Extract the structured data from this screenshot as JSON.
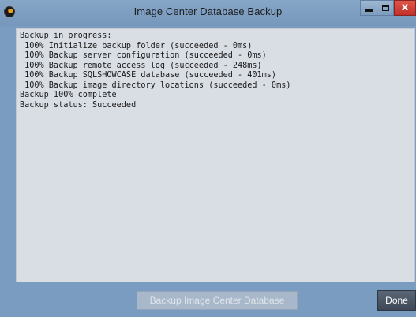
{
  "window": {
    "title": "Image Center Database Backup",
    "close_label": "x"
  },
  "log": {
    "lines": [
      "Backup in progress:",
      " 100% Initialize backup folder (succeeded - 0ms)",
      " 100% Backup server configuration (succeeded - 0ms)",
      " 100% Backup remote access log (succeeded - 248ms)",
      " 100% Backup SQLSHOWCASE database (succeeded - 401ms)",
      " 100% Backup image directory locations (succeeded - 0ms)",
      "Backup 100% complete",
      "Backup status: Succeeded"
    ]
  },
  "buttons": {
    "backup_label": "Backup Image Center Database",
    "done_label": "Done"
  },
  "colors": {
    "frame": "#7a9cc0",
    "log_background": "#d9dde4",
    "close_button": "#c1302a",
    "done_button": "#3e4857"
  },
  "icons": {
    "app": "app-logo-icon",
    "minimize": "minimize-icon",
    "maximize": "maximize-icon",
    "close": "close-icon"
  }
}
